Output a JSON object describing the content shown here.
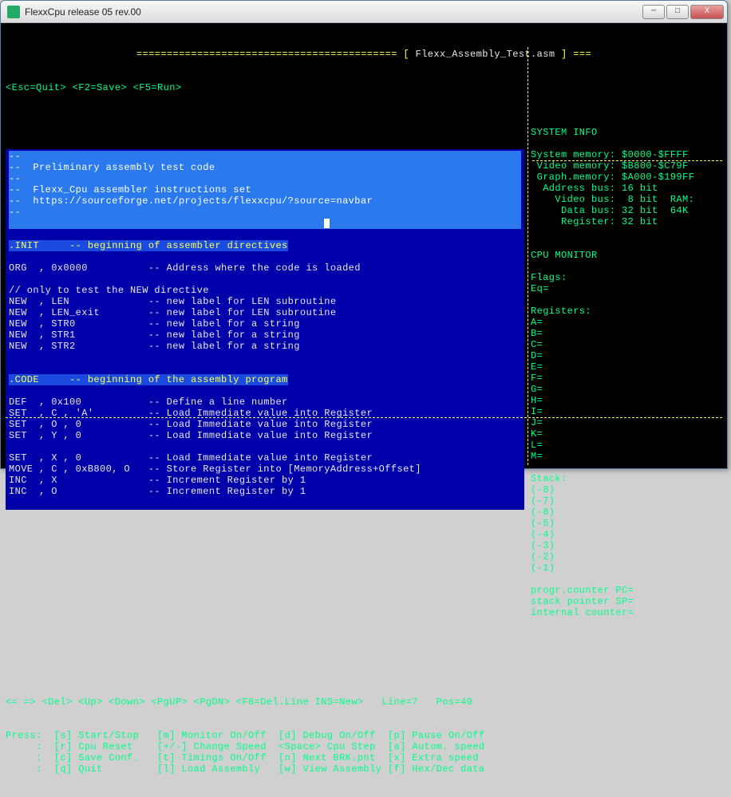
{
  "window": {
    "title": "FlexxCpu release 05 rev.00"
  },
  "header": {
    "filename": "Flexx_Assembly_Test.asm",
    "keys": "<Esc=Quit> <F2=Save> <F5=Run>"
  },
  "editor_lines": [
    {
      "cls": "hl",
      "txt": "--"
    },
    {
      "cls": "hl",
      "txt": "--  Preliminary assembly test code"
    },
    {
      "cls": "hl",
      "txt": "--"
    },
    {
      "cls": "hl",
      "txt": "--  Flexx_Cpu assembler instructions set"
    },
    {
      "cls": "hl",
      "txt": "--  https://sourceforge.net/projects/flexxcpu/?source=navbar"
    },
    {
      "cls": "hl",
      "txt": "--"
    },
    {
      "cls": "cur",
      "txt": ""
    },
    {
      "cls": "",
      "txt": ""
    },
    {
      "cls": "sec",
      "txt": ".INIT     -- beginning of assembler directives"
    },
    {
      "cls": "",
      "txt": ""
    },
    {
      "cls": "",
      "txt": "ORG  , 0x0000          -- Address where the code is loaded"
    },
    {
      "cls": "",
      "txt": ""
    },
    {
      "cls": "",
      "txt": "// only to test the NEW directive"
    },
    {
      "cls": "",
      "txt": "NEW  , LEN             -- new label for LEN subroutine"
    },
    {
      "cls": "",
      "txt": "NEW  , LEN_exit        -- new label for LEN subroutine"
    },
    {
      "cls": "",
      "txt": "NEW  , STR0            -- new label for a string"
    },
    {
      "cls": "",
      "txt": "NEW  , STR1            -- new label for a string"
    },
    {
      "cls": "",
      "txt": "NEW  , STR2            -- new label for a string"
    },
    {
      "cls": "",
      "txt": ""
    },
    {
      "cls": "",
      "txt": ""
    },
    {
      "cls": "sec",
      "txt": ".CODE     -- beginning of the assembly program"
    },
    {
      "cls": "",
      "txt": ""
    },
    {
      "cls": "",
      "txt": "DEF  , 0x100           -- Define a line number"
    },
    {
      "cls": "",
      "txt": "SET  , C , 'A'         -- Load Immediate value into Register"
    },
    {
      "cls": "",
      "txt": "SET  , O , 0           -- Load Immediate value into Register"
    },
    {
      "cls": "",
      "txt": "SET  , Y , 0           -- Load Immediate value into Register"
    },
    {
      "cls": "",
      "txt": ""
    },
    {
      "cls": "",
      "txt": "SET  , X , 0           -- Load Immediate value into Register"
    },
    {
      "cls": "",
      "txt": "MOVE , C , 0xB800, O   -- Store Register into [MemoryAddress+Offset]"
    },
    {
      "cls": "",
      "txt": "INC  , X               -- Increment Register by 1"
    },
    {
      "cls": "",
      "txt": "INC  , O               -- Increment Register by 1"
    },
    {
      "cls": "",
      "txt": ""
    }
  ],
  "sysinfo": {
    "title": "SYSTEM INFO",
    "lines": [
      "System memory: $0000-$FFFF",
      " Video memory: $B800-$C79F",
      " Graph.memory: $A000-$199FF",
      "  Address bus: 16 bit",
      "    Video bus:  8 bit  RAM:",
      "     Data bus: 32 bit  64K",
      "     Register: 32 bit"
    ]
  },
  "cpumon": {
    "title": "CPU MONITOR",
    "flags": "Flags:",
    "eq": "Eq=",
    "reg_title": "Registers:",
    "regs": [
      "A=",
      "B=",
      "C=",
      "D=",
      "E=",
      "F=",
      "G=",
      "H=",
      "I=",
      "J=",
      "K=",
      "L=",
      "M="
    ],
    "stack_title": "Stack:",
    "stack": [
      "(-8)",
      "(-7)",
      "(-6)",
      "(-5)",
      "(-4)",
      "(-3)",
      "(-2)",
      "(-1)"
    ],
    "pc": "progr.counter PC=",
    "sp": "stack pointer SP=",
    "ic": "internal counter="
  },
  "footer": {
    "nav": "<= => <Del> <Up> <Down> <PgUP> <PgDN> <F8=Del.Line INS=New>   Line=7   Pos=49",
    "help": [
      "Press:  [s] Start/Stop   [m] Monitor On/Off  [d] Debug On/Off  [p] Pause On/Off",
      "     :  [r] Cpu Reset    [+/-] Change Speed  <Space> Cpu Step  [a] Autom. speed",
      "     :  [c] Save Conf.   [t] Timings On/Off  [n] Next BRK.pnt  [x] Extra speed",
      "     :  [q] Quit         [l] Load Assembly   [w] View Assembly [f] Hex/Dec data"
    ]
  }
}
